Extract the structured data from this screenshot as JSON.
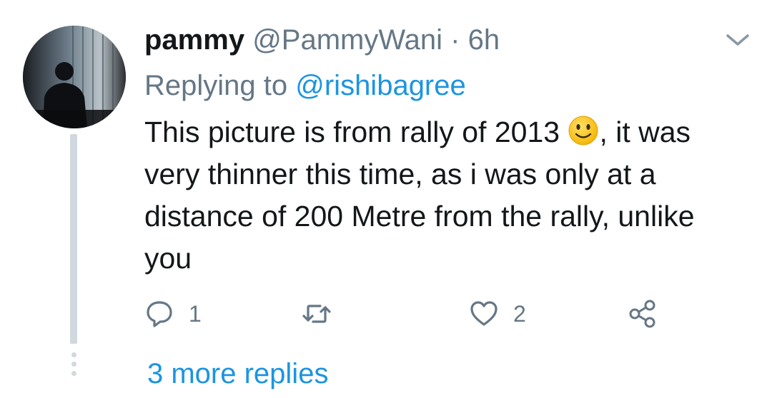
{
  "tweet": {
    "display_name": "pammy",
    "handle": "@PammyWani",
    "separator": "·",
    "time": "6h",
    "replying_prefix": "Replying to",
    "replying_to": "@rishibagree",
    "text_part1": "This picture is from rally of 2013",
    "emoji": "slightly-smiling-face-icon",
    "text_part2": ", it was very thinner this time, as i was only at a distance of 200 Metre from the rally, unlike you",
    "reply_count": "1",
    "retweet_count": "",
    "like_count": "2",
    "more_replies": "3 more replies"
  },
  "icons": {
    "menu": "chevron-down-icon",
    "reply": "reply-bubble-icon",
    "retweet": "retweet-icon",
    "like": "heart-icon",
    "share": "share-icon"
  },
  "colors": {
    "link": "#1b95e0",
    "secondary_text": "#657786",
    "thread_line": "#cfd9de"
  }
}
